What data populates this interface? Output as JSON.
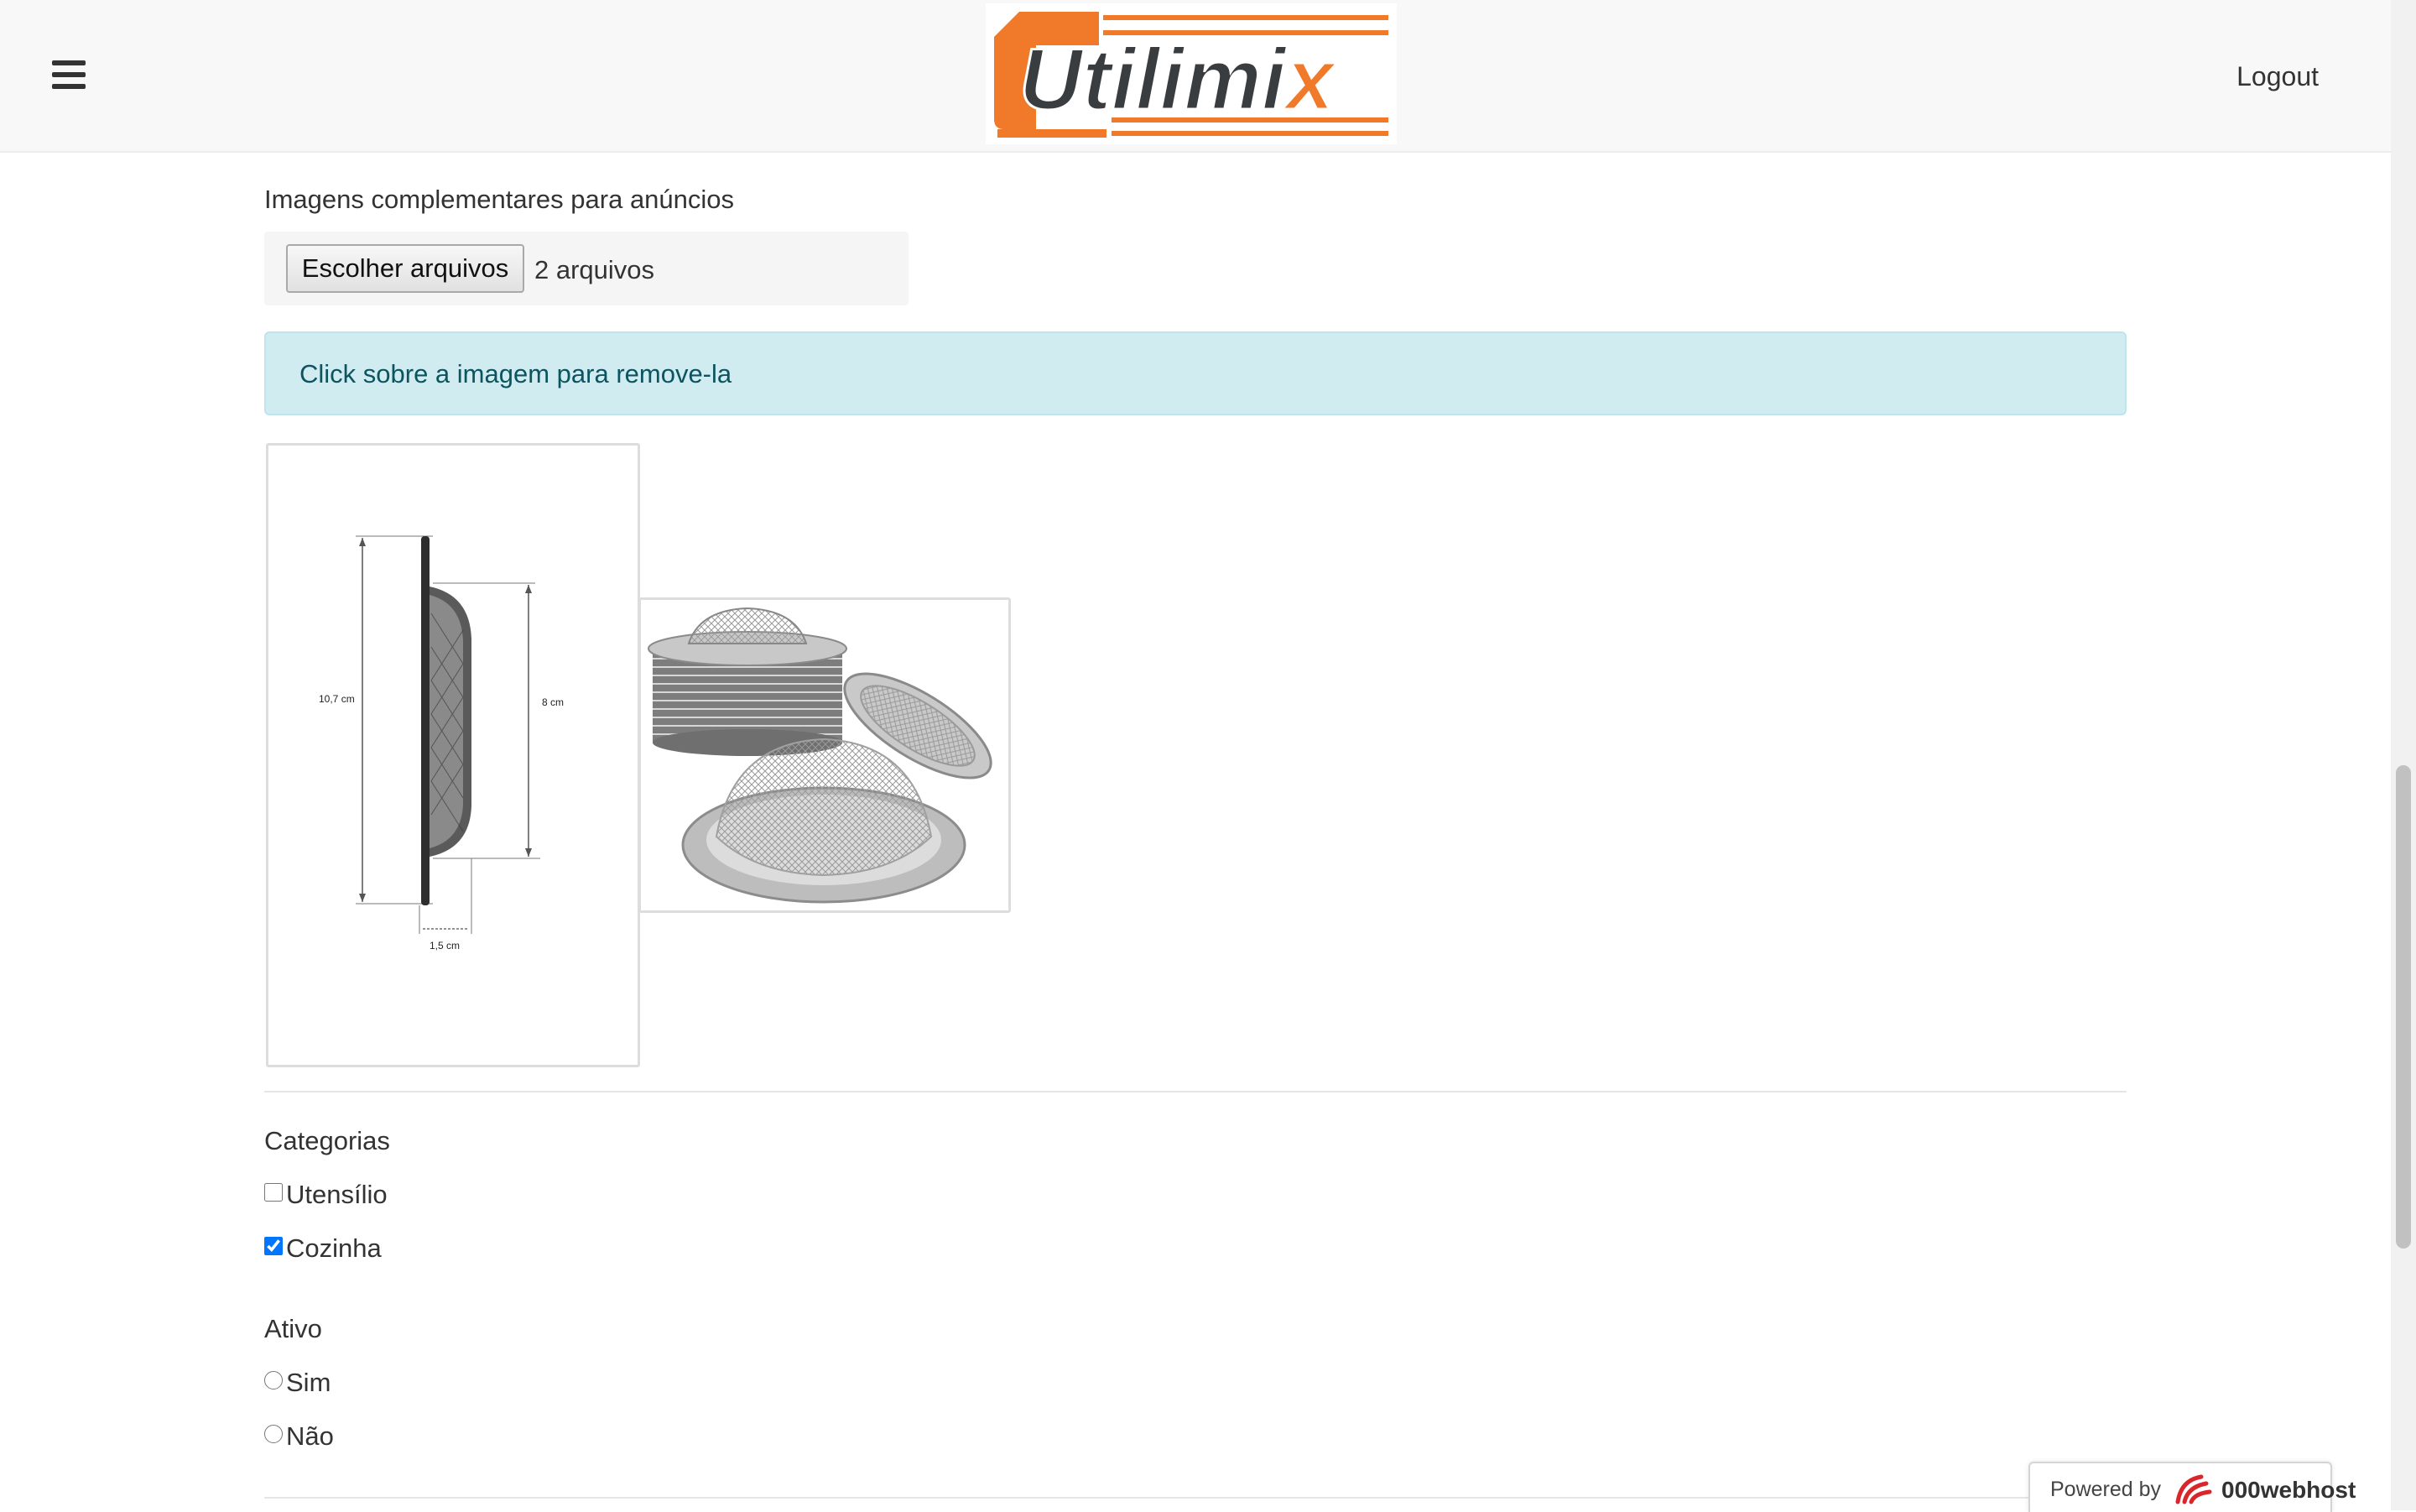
{
  "header": {
    "menu_icon": "hamburger-menu-icon",
    "logo_text_a": "U",
    "logo_text_b": "tilimi",
    "logo_text_c": "x",
    "logout_label": "Logout",
    "colors": {
      "brand_orange": "#f07a2a",
      "brand_dark": "#3a3d40"
    }
  },
  "files": {
    "label": "Imagens complementares para anúncios",
    "button_label": "Escolher arquivos",
    "status": "2 arquivos"
  },
  "alert": {
    "text": "Click sobre a imagem para remove-la",
    "colors": {
      "background": "#d1ecf1",
      "text": "#0c5460"
    }
  },
  "images": [
    {
      "name": "strainer-dimensions",
      "label_height": "10,7 cm",
      "label_inner": "8 cm",
      "label_depth": "1,5 cm"
    },
    {
      "name": "strainer-stack"
    }
  ],
  "categories": {
    "label": "Categorias",
    "items": [
      {
        "label": "Utensílio",
        "checked": false
      },
      {
        "label": "Cozinha",
        "checked": true
      }
    ]
  },
  "ativo": {
    "label": "Ativo",
    "options": [
      {
        "label": "Sim",
        "selected": false
      },
      {
        "label": "Não",
        "selected": false
      }
    ]
  },
  "footer_badge": {
    "powered_by": "Powered by",
    "brand": "000webhost"
  }
}
